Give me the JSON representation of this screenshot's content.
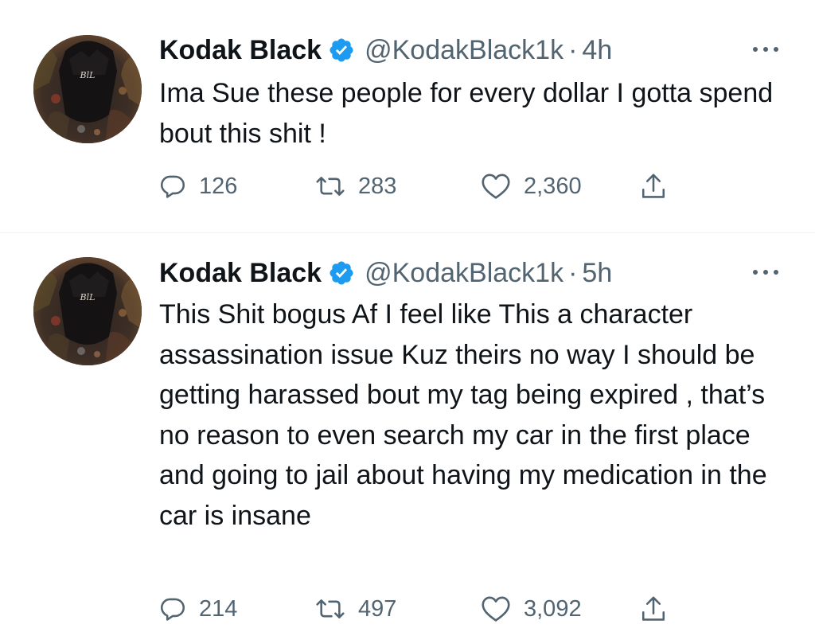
{
  "tweets": [
    {
      "author": {
        "name": "Kodak Black",
        "handle": "@KodakBlack1k",
        "verified_icon": "verified-badge-icon",
        "avatar_label": "BlL"
      },
      "separator": "·",
      "time": "4h",
      "text": "Ima Sue these people for every dollar I gotta spend bout this shit !",
      "stats": {
        "replies": "126",
        "retweets": "283",
        "likes": "2,360"
      }
    },
    {
      "author": {
        "name": "Kodak Black",
        "handle": "@KodakBlack1k",
        "verified_icon": "verified-badge-icon",
        "avatar_label": "BlL"
      },
      "separator": "·",
      "time": "5h",
      "text": "This Shit bogus Af I feel like This a character assassination issue Kuz theirs no way I should be getting harassed bout my tag being expired , that’s no reason to even search my car in the first place and going to jail about having my medication in the car is insane",
      "stats": {
        "replies": "214",
        "retweets": "497",
        "likes": "3,092"
      }
    }
  ],
  "icons": {
    "reply": "reply-icon",
    "retweet": "retweet-icon",
    "like": "heart-icon",
    "share": "share-icon",
    "more": "more-options-icon"
  },
  "colors": {
    "verified": "#1d9bf0",
    "text": "#0f1419",
    "secondary": "#536471",
    "divider": "#eff3f4"
  }
}
